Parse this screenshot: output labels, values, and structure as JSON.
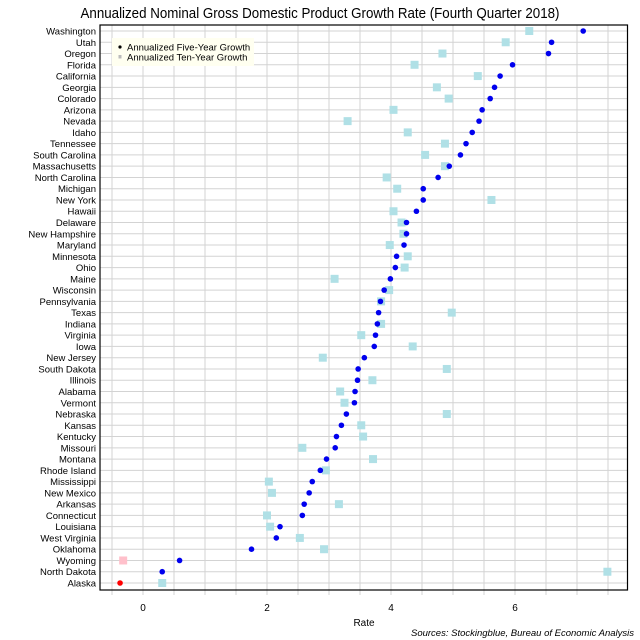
{
  "chart_data": {
    "type": "scatter",
    "title": "Annualized Nominal Gross Domestic Product Growth Rate (Fourth Quarter 2018)",
    "xlabel": "Rate",
    "ylabel": "",
    "xlim": [
      -0.7,
      7.8
    ],
    "xticks": [
      0,
      2,
      4,
      6
    ],
    "grid_step": 0.5,
    "grid": true,
    "legend_position": "top-left",
    "sources": "Sources: Stockingblue, Bureau of Economic Analysis",
    "categories": [
      "Washington",
      "Utah",
      "Oregon",
      "Florida",
      "California",
      "Georgia",
      "Colorado",
      "Arizona",
      "Nevada",
      "Idaho",
      "Tennessee",
      "South Carolina",
      "Massachusetts",
      "North Carolina",
      "Michigan",
      "New York",
      "Hawaii",
      "Delaware",
      "New Hampshire",
      "Maryland",
      "Minnesota",
      "Ohio",
      "Maine",
      "Wisconsin",
      "Pennsylvania",
      "Texas",
      "Indiana",
      "Virginia",
      "Iowa",
      "New Jersey",
      "South Dakota",
      "Illinois",
      "Alabama",
      "Vermont",
      "Nebraska",
      "Kansas",
      "Kentucky",
      "Missouri",
      "Montana",
      "Rhode Island",
      "Mississippi",
      "New Mexico",
      "Arkansas",
      "Connecticut",
      "Louisiana",
      "West Virginia",
      "Oklahoma",
      "Wyoming",
      "North Dakota",
      "Alaska"
    ],
    "series": [
      {
        "name": "Annualized Five-Year Growth",
        "marker": "circle",
        "color": "#0000ee",
        "negative_color": "#ff0000",
        "values": [
          7.1,
          6.59,
          6.54,
          5.96,
          5.76,
          5.67,
          5.6,
          5.47,
          5.42,
          5.31,
          5.21,
          5.12,
          4.94,
          4.76,
          4.52,
          4.52,
          4.41,
          4.25,
          4.25,
          4.21,
          4.09,
          4.07,
          3.99,
          3.89,
          3.83,
          3.8,
          3.78,
          3.75,
          3.73,
          3.57,
          3.47,
          3.46,
          3.42,
          3.41,
          3.28,
          3.2,
          3.12,
          3.1,
          2.96,
          2.86,
          2.73,
          2.68,
          2.6,
          2.57,
          2.21,
          2.15,
          1.75,
          0.59,
          0.31,
          -0.37
        ]
      },
      {
        "name": "Annualized Ten-Year Growth",
        "marker": "square",
        "color": "#b0e0e6",
        "negative_color": "#ffc0cb",
        "values": [
          6.23,
          5.85,
          4.83,
          4.38,
          5.4,
          4.74,
          4.93,
          4.04,
          3.3,
          4.27,
          4.87,
          4.55,
          4.87,
          3.93,
          4.1,
          5.62,
          4.04,
          4.17,
          4.2,
          3.98,
          4.27,
          4.22,
          3.09,
          3.97,
          3.84,
          4.98,
          3.84,
          3.52,
          4.35,
          2.9,
          4.9,
          3.7,
          3.18,
          3.25,
          4.9,
          3.52,
          3.55,
          2.57,
          3.71,
          2.95,
          2.03,
          2.08,
          3.16,
          2.0,
          2.05,
          2.53,
          2.92,
          -0.32,
          7.49,
          0.31
        ]
      }
    ]
  }
}
